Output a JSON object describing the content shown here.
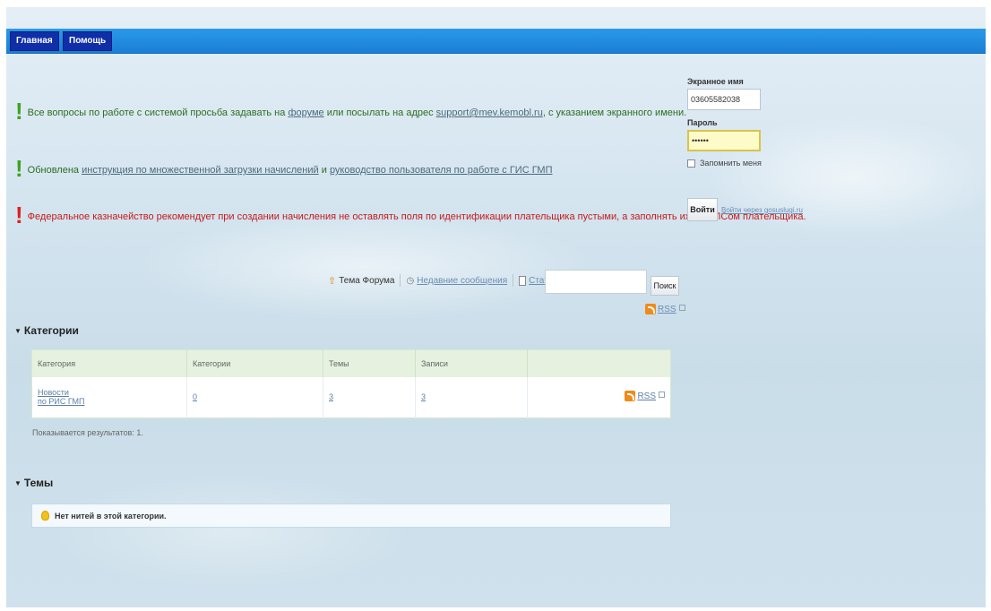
{
  "nav": {
    "home_label": "Главная",
    "help_label": "Помощь"
  },
  "notices": {
    "forum": {
      "before": "Все вопросы по работе с системой просьба задавать на ",
      "forum_link": "форуме",
      "middle": " или посылать на адрес ",
      "email_link": "support@mev.kemobl.ru",
      "after": ", с указанием экранного имени."
    },
    "update": {
      "before": "Обновлена ",
      "instruction_link": "инструкция по множественной загрузки начислений",
      "middle": " и ",
      "manual_link": "руководство пользователя по работе с ГИС ГМП"
    },
    "treasury": {
      "text": "Федеральное казначейство рекомендует при создании начисления не оставлять поля по идентификации плательщика пустыми, а заполнять их СНИЛСом плательщика."
    }
  },
  "login": {
    "screen_name_label": "Экранное имя",
    "screen_name_value": "03605582038",
    "password_label": "Пароль",
    "password_value": "••••••",
    "remember_label": "Запомнить меня",
    "login_button": "Войти",
    "gosuslugi_link": "Войти через gosuslugi.ru"
  },
  "toolbar": {
    "forum_theme": "Тема Форума",
    "recent_posts": "Недавние сообщения",
    "statistics": "Статистика",
    "search_button": "Поиск",
    "rss": "RSS"
  },
  "categories": {
    "title": "Категории",
    "columns": [
      "Категория",
      "Категории",
      "Темы",
      "Записи",
      ""
    ],
    "rows": [
      {
        "name_line1": "Новости",
        "name_line2": "по РИС ГМП",
        "subcategories": "0",
        "threads": "3",
        "posts": "3",
        "rss": "RSS"
      }
    ],
    "results_text": "Показывается результатов: 1."
  },
  "threads": {
    "title": "Темы",
    "empty_text": "Нет нитей в этой категории."
  },
  "colors": {
    "topbar": "#1a7fd6",
    "nav_button": "#0f2ea8",
    "notice_green": "#2c6e21",
    "notice_red": "#c51a1a",
    "table_header": "#e6f2df"
  }
}
